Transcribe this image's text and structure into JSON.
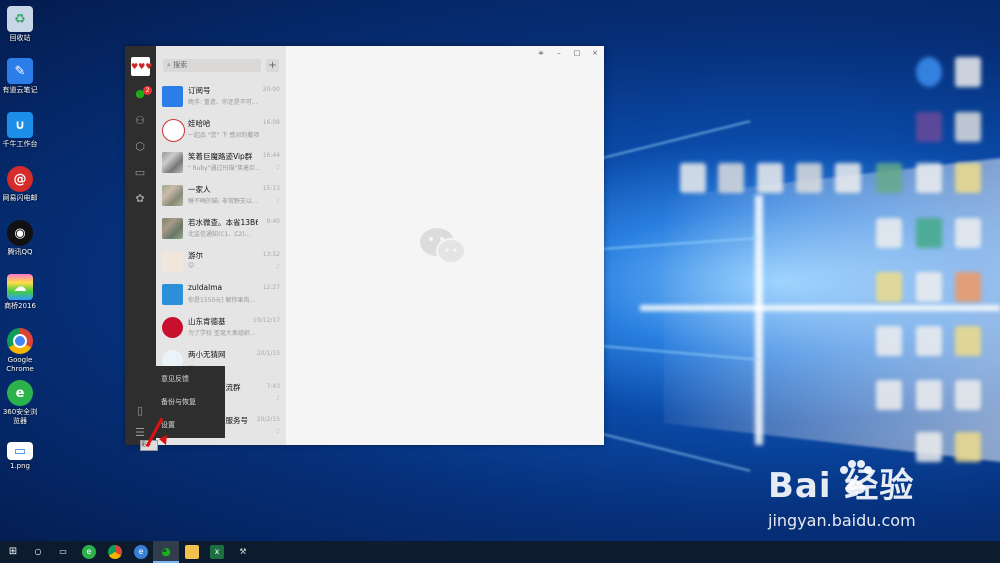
{
  "desktop": {
    "icons": [
      {
        "label": "回收站",
        "icon": "recycle-bin-icon"
      },
      {
        "label": "有道云笔记",
        "icon": "youdao-note-icon"
      },
      {
        "label": "千牛工作台",
        "icon": "qianniu-icon"
      },
      {
        "label": "网易闪电邮",
        "icon": "netease-mail-icon"
      },
      {
        "label": "腾讯QQ",
        "icon": "qq-icon"
      },
      {
        "label": "商桥2016",
        "icon": "shangqiao-icon"
      },
      {
        "label": "Google Chrome",
        "icon": "chrome-icon"
      },
      {
        "label": "360安全浏览器",
        "icon": "360-browser-icon"
      },
      {
        "label": "1.png",
        "icon": "image-file-icon"
      }
    ]
  },
  "wechat": {
    "search_placeholder": "搜索",
    "plus_label": "+",
    "unread_badge": "2",
    "window_controls": {
      "pin": "≑",
      "minimize": "–",
      "maximize": "□",
      "close": "×"
    },
    "chats": [
      {
        "name": "订阅号",
        "message": "晚手: 重造、你还是不可...",
        "time": "20:00"
      },
      {
        "name": "娃哈哈",
        "message": "一起品 \"您\" 下 感对的撒项",
        "time": "16:09"
      },
      {
        "name": "笑着巨魔路迹Vip群",
        "message": "\" Ruby\"通过扫描\"笑着巨...",
        "time": "16:44"
      },
      {
        "name": "一家人",
        "message": "睡不晦的猫: 非常野支以...",
        "time": "15:13"
      },
      {
        "name": "若水微查。本省13B69...",
        "message": "北监信通知(C1、C2)...",
        "time": "9:40"
      },
      {
        "name": "游尔",
        "message": "😊",
        "time": "13:52"
      },
      {
        "name": "zuldalma",
        "message": "你是1550元] 解你果肉...",
        "time": "12:27"
      },
      {
        "name": "山东肯德基",
        "message": "为了学校 圣诞大奥组织...",
        "time": "19/12/17"
      },
      {
        "name": "两小无猜网",
        "message": "...",
        "time": "20/1/15"
      },
      {
        "name": "交流群",
        "message": "",
        "time": "7:43"
      },
      {
        "name": "方服务号",
        "message": "",
        "time": "20/2/15"
      }
    ],
    "menu": [
      "意见反馈",
      "备份与恢复",
      "设置"
    ],
    "tooltip": "更多"
  },
  "watermark": {
    "brand": "Bai 经验",
    "url": "jingyan.baidu.com"
  },
  "taskbar": {
    "icons": [
      "start-icon",
      "search-icon",
      "task-view-icon",
      "360-icon",
      "chrome-icon",
      "edge-icon",
      "wechat-icon",
      "explorer-icon",
      "excel-icon",
      "tools-icon"
    ]
  }
}
